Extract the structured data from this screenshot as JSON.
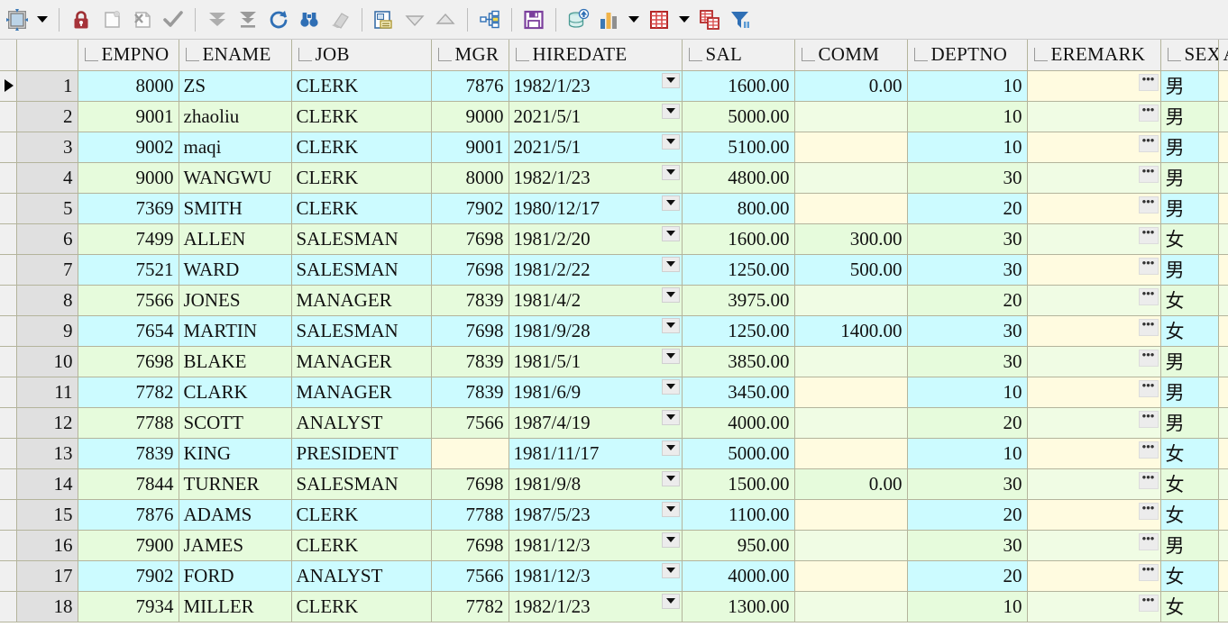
{
  "toolbar": {
    "groups": [
      {
        "buttons": [
          {
            "name": "select-tool-icon",
            "label": "Select"
          },
          {
            "name": "chevron-down-icon",
            "label": "More"
          }
        ]
      },
      {
        "buttons": [
          {
            "name": "lock-icon",
            "label": "Lock record"
          },
          {
            "name": "new-record-icon",
            "label": "New record"
          },
          {
            "name": "delete-record-icon",
            "label": "Delete record"
          },
          {
            "name": "post-record-icon",
            "label": "Post record"
          }
        ]
      },
      {
        "buttons": [
          {
            "name": "move-down-icon",
            "label": "Next record"
          },
          {
            "name": "move-last-icon",
            "label": "Last record"
          },
          {
            "name": "refresh-icon",
            "label": "Refresh"
          },
          {
            "name": "find-icon",
            "label": "Find"
          },
          {
            "name": "eraser-icon",
            "label": "Clear"
          }
        ]
      },
      {
        "buttons": [
          {
            "name": "form-view-icon",
            "label": "Form view"
          },
          {
            "name": "collapse-icon",
            "label": "Collapse"
          },
          {
            "name": "expand-icon",
            "label": "Expand"
          }
        ]
      },
      {
        "buttons": [
          {
            "name": "tree-view-icon",
            "label": "Tree view"
          }
        ]
      },
      {
        "buttons": [
          {
            "name": "save-icon",
            "label": "Save"
          }
        ]
      },
      {
        "buttons": [
          {
            "name": "database-upload-icon",
            "label": "Commit to database"
          },
          {
            "name": "chart-icon",
            "label": "Chart"
          },
          {
            "name": "chart-dropdown-icon",
            "label": "Chart options"
          },
          {
            "name": "grid-icon",
            "label": "Grid"
          },
          {
            "name": "grid-dropdown-icon",
            "label": "Grid options"
          },
          {
            "name": "multi-table-icon",
            "label": "Multi table"
          },
          {
            "name": "filter-icon",
            "label": "Filter"
          }
        ]
      }
    ]
  },
  "grid": {
    "columns": [
      {
        "key": "EMPNO",
        "label": "EMPNO",
        "align": "num"
      },
      {
        "key": "ENAME",
        "label": "ENAME",
        "align": "txt"
      },
      {
        "key": "JOB",
        "label": "JOB",
        "align": "txt"
      },
      {
        "key": "MGR",
        "label": "MGR",
        "align": "num"
      },
      {
        "key": "HIREDATE",
        "label": "HIREDATE",
        "align": "txt"
      },
      {
        "key": "SAL",
        "label": "SAL",
        "align": "num"
      },
      {
        "key": "COMM",
        "label": "COMM",
        "align": "num"
      },
      {
        "key": "DEPTNO",
        "label": "DEPTNO",
        "align": "num"
      },
      {
        "key": "EREMARK",
        "label": "EREMARK",
        "align": "txt"
      },
      {
        "key": "SEX",
        "label": "SEX",
        "align": "txt"
      },
      {
        "key": "LAST",
        "label": "A",
        "align": "txt"
      }
    ],
    "memo_button_label": "•••",
    "current_row": 1,
    "rows": [
      {
        "n": 1,
        "EMPNO": "8000",
        "ENAME": "ZS",
        "JOB": "CLERK",
        "MGR": "7876",
        "HIREDATE": "1982/1/23",
        "SAL": "1600.00",
        "COMM": "0.00",
        "DEPTNO": "10",
        "EREMARK": "",
        "SEX": "男"
      },
      {
        "n": 2,
        "EMPNO": "9001",
        "ENAME": "zhaoliu",
        "JOB": "CLERK",
        "MGR": "9000",
        "HIREDATE": "2021/5/1",
        "SAL": "5000.00",
        "COMM": "",
        "DEPTNO": "10",
        "EREMARK": "",
        "SEX": "男"
      },
      {
        "n": 3,
        "EMPNO": "9002",
        "ENAME": "maqi",
        "JOB": "CLERK",
        "MGR": "9001",
        "HIREDATE": "2021/5/1",
        "SAL": "5100.00",
        "COMM": "",
        "DEPTNO": "10",
        "EREMARK": "",
        "SEX": "男"
      },
      {
        "n": 4,
        "EMPNO": "9000",
        "ENAME": "WANGWU",
        "JOB": "CLERK",
        "MGR": "8000",
        "HIREDATE": "1982/1/23",
        "SAL": "4800.00",
        "COMM": "",
        "DEPTNO": "30",
        "EREMARK": "",
        "SEX": "男"
      },
      {
        "n": 5,
        "EMPNO": "7369",
        "ENAME": "SMITH",
        "JOB": "CLERK",
        "MGR": "7902",
        "HIREDATE": "1980/12/17",
        "SAL": "800.00",
        "COMM": "",
        "DEPTNO": "20",
        "EREMARK": "",
        "SEX": "男"
      },
      {
        "n": 6,
        "EMPNO": "7499",
        "ENAME": "ALLEN",
        "JOB": "SALESMAN",
        "MGR": "7698",
        "HIREDATE": "1981/2/20",
        "SAL": "1600.00",
        "COMM": "300.00",
        "DEPTNO": "30",
        "EREMARK": "",
        "SEX": "女"
      },
      {
        "n": 7,
        "EMPNO": "7521",
        "ENAME": "WARD",
        "JOB": "SALESMAN",
        "MGR": "7698",
        "HIREDATE": "1981/2/22",
        "SAL": "1250.00",
        "COMM": "500.00",
        "DEPTNO": "30",
        "EREMARK": "",
        "SEX": "男"
      },
      {
        "n": 8,
        "EMPNO": "7566",
        "ENAME": "JONES",
        "JOB": "MANAGER",
        "MGR": "7839",
        "HIREDATE": "1981/4/2",
        "SAL": "3975.00",
        "COMM": "",
        "DEPTNO": "20",
        "EREMARK": "",
        "SEX": "女"
      },
      {
        "n": 9,
        "EMPNO": "7654",
        "ENAME": "MARTIN",
        "JOB": "SALESMAN",
        "MGR": "7698",
        "HIREDATE": "1981/9/28",
        "SAL": "1250.00",
        "COMM": "1400.00",
        "DEPTNO": "30",
        "EREMARK": "",
        "SEX": "女"
      },
      {
        "n": 10,
        "EMPNO": "7698",
        "ENAME": "BLAKE",
        "JOB": "MANAGER",
        "MGR": "7839",
        "HIREDATE": "1981/5/1",
        "SAL": "3850.00",
        "COMM": "",
        "DEPTNO": "30",
        "EREMARK": "",
        "SEX": "男"
      },
      {
        "n": 11,
        "EMPNO": "7782",
        "ENAME": "CLARK",
        "JOB": "MANAGER",
        "MGR": "7839",
        "HIREDATE": "1981/6/9",
        "SAL": "3450.00",
        "COMM": "",
        "DEPTNO": "10",
        "EREMARK": "",
        "SEX": "男"
      },
      {
        "n": 12,
        "EMPNO": "7788",
        "ENAME": "SCOTT",
        "JOB": "ANALYST",
        "MGR": "7566",
        "HIREDATE": "1987/4/19",
        "SAL": "4000.00",
        "COMM": "",
        "DEPTNO": "20",
        "EREMARK": "",
        "SEX": "男"
      },
      {
        "n": 13,
        "EMPNO": "7839",
        "ENAME": "KING",
        "JOB": "PRESIDENT",
        "MGR": "",
        "HIREDATE": "1981/11/17",
        "SAL": "5000.00",
        "COMM": "",
        "DEPTNO": "10",
        "EREMARK": "",
        "SEX": "女"
      },
      {
        "n": 14,
        "EMPNO": "7844",
        "ENAME": "TURNER",
        "JOB": "SALESMAN",
        "MGR": "7698",
        "HIREDATE": "1981/9/8",
        "SAL": "1500.00",
        "COMM": "0.00",
        "DEPTNO": "30",
        "EREMARK": "",
        "SEX": "女"
      },
      {
        "n": 15,
        "EMPNO": "7876",
        "ENAME": "ADAMS",
        "JOB": "CLERK",
        "MGR": "7788",
        "HIREDATE": "1987/5/23",
        "SAL": "1100.00",
        "COMM": "",
        "DEPTNO": "20",
        "EREMARK": "",
        "SEX": "女"
      },
      {
        "n": 16,
        "EMPNO": "7900",
        "ENAME": "JAMES",
        "JOB": "CLERK",
        "MGR": "7698",
        "HIREDATE": "1981/12/3",
        "SAL": "950.00",
        "COMM": "",
        "DEPTNO": "30",
        "EREMARK": "",
        "SEX": "男"
      },
      {
        "n": 17,
        "EMPNO": "7902",
        "ENAME": "FORD",
        "JOB": "ANALYST",
        "MGR": "7566",
        "HIREDATE": "1981/12/3",
        "SAL": "4000.00",
        "COMM": "",
        "DEPTNO": "20",
        "EREMARK": "",
        "SEX": "女"
      },
      {
        "n": 18,
        "EMPNO": "7934",
        "ENAME": "MILLER",
        "JOB": "CLERK",
        "MGR": "7782",
        "HIREDATE": "1982/1/23",
        "SAL": "1300.00",
        "COMM": "",
        "DEPTNO": "10",
        "EREMARK": "",
        "SEX": "女"
      }
    ]
  },
  "colors": {
    "row_odd": "#ccfbff",
    "row_even": "#e6fbdc",
    "null_odd": "#fffbe0",
    "null_even": "#f0fce4",
    "toolbar_bg": "#f0f0f0",
    "rowheader_bg": "#e0e0e0",
    "gridline": "#b4b49c"
  }
}
